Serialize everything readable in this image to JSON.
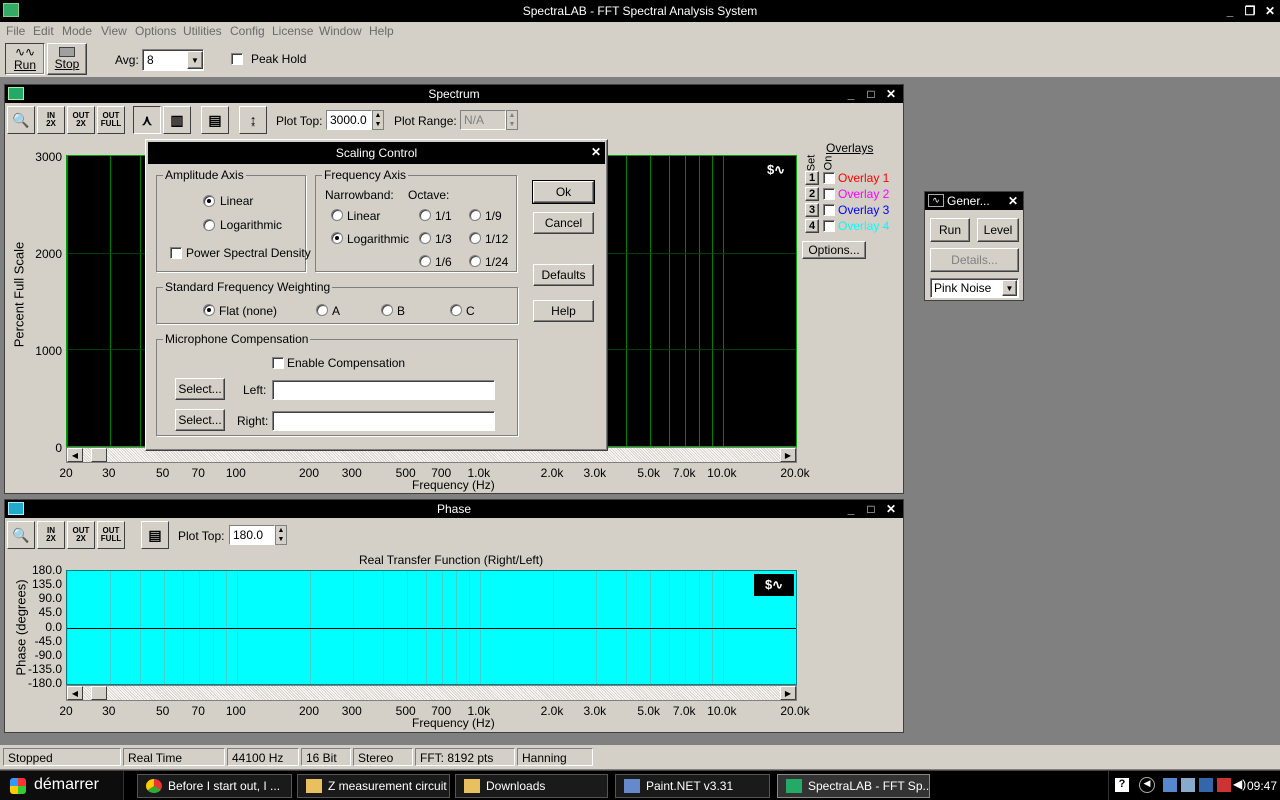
{
  "app": {
    "title": "SpectraLAB - FFT Spectral Analysis System",
    "menu": [
      "File",
      "Edit",
      "Mode",
      "View",
      "Options",
      "Utilities",
      "Config",
      "License",
      "Window",
      "Help"
    ],
    "toolbar": {
      "run_label": "Run",
      "stop_label": "Stop",
      "avg_label": "Avg:",
      "avg_value": "8",
      "peak_hold_label": "Peak Hold"
    }
  },
  "spectrum": {
    "title": "Spectrum",
    "plot_top_label": "Plot Top:",
    "plot_top_value": "3000.0",
    "plot_range_label": "Plot Range:",
    "plot_range_value": "N/A",
    "ylabel": "Percent Full Scale",
    "xlabel": "Frequency (Hz)",
    "y_ticks": [
      "3000",
      "2000",
      "1000",
      "0"
    ],
    "x_ticks": [
      "20",
      "30",
      "50",
      "70",
      "100",
      "200",
      "300",
      "500",
      "700",
      "1.0k",
      "2.0k",
      "3.0k",
      "5.0k",
      "7.0k",
      "10.0k",
      "20.0k"
    ],
    "overlays_title": "Overlays",
    "set_label": "Set",
    "on_label": "On",
    "overlays": [
      {
        "num": "1",
        "name": "Overlay 1",
        "color": "#ff0000"
      },
      {
        "num": "2",
        "name": "Overlay 2",
        "color": "#ff00ff"
      },
      {
        "num": "3",
        "name": "Overlay 3",
        "color": "#0000ff"
      },
      {
        "num": "4",
        "name": "Overlay 4",
        "color": "#00ffff"
      }
    ],
    "options_label": "Options...",
    "tb_labels": {
      "zoom_in": "IN\n2X",
      "zoom_out": "OUT\n2X",
      "full": "OUT\nFULL"
    }
  },
  "dialog": {
    "title": "Scaling Control",
    "amplitude_axis": "Amplitude Axis",
    "linear": "Linear",
    "logarithmic": "Logarithmic",
    "psd": "Power Spectral Density",
    "frequency_axis": "Frequency Axis",
    "narrowband": "Narrowband:",
    "octave": "Octave:",
    "octaves": [
      "1/1",
      "1/9",
      "1/3",
      "1/12",
      "1/6",
      "1/24"
    ],
    "weighting_title": "Standard Frequency Weighting",
    "weightings": [
      "Flat (none)",
      "A",
      "B",
      "C"
    ],
    "mic_title": "Microphone Compensation",
    "enable_comp": "Enable Compensation",
    "select": "Select...",
    "left": "Left:",
    "right": "Right:",
    "left_value": "",
    "right_value": "",
    "ok": "Ok",
    "cancel": "Cancel",
    "defaults": "Defaults",
    "help": "Help"
  },
  "generator": {
    "title": "Gener...",
    "run": "Run",
    "level": "Level",
    "details": "Details...",
    "noise_value": "Pink Noise"
  },
  "phase": {
    "title": "Phase",
    "plot_top_label": "Plot Top:",
    "plot_top_value": "180.0",
    "chart_title": "Real Transfer Function (Right/Left)",
    "ylabel": "Phase (degrees)",
    "xlabel": "Frequency (Hz)",
    "y_ticks": [
      "180.0",
      "135.0",
      "90.0",
      "45.0",
      "0.0",
      "-45.0",
      "-90.0",
      "-135.0",
      "-180.0"
    ],
    "x_ticks": [
      "20",
      "30",
      "50",
      "70",
      "100",
      "200",
      "300",
      "500",
      "700",
      "1.0k",
      "2.0k",
      "3.0k",
      "5.0k",
      "7.0k",
      "10.0k",
      "20.0k"
    ]
  },
  "status": [
    "Stopped",
    "Real Time",
    "44100 Hz",
    "16 Bit",
    "Stereo",
    "FFT: 8192 pts",
    "Hanning"
  ],
  "taskbar": {
    "start": "démarrer",
    "tasks": [
      "Before I start out, I ...",
      "Z measurement circuit",
      "Downloads",
      "Paint.NET v3.31",
      "SpectraLAB - FFT Sp..."
    ],
    "clock": "09:47"
  },
  "colors": {
    "spectrum_bg": "#000000",
    "grid_green": "#008000",
    "phase_bg": "#00ffff"
  },
  "chart_data": [
    {
      "type": "line",
      "title": "",
      "xlabel": "Frequency (Hz)",
      "ylabel": "Percent Full Scale",
      "x_scale": "log",
      "xlim": [
        20,
        20000
      ],
      "ylim": [
        0,
        3000
      ],
      "grid": true,
      "series": []
    },
    {
      "type": "line",
      "title": "Real Transfer Function (Right/Left)",
      "xlabel": "Frequency (Hz)",
      "ylabel": "Phase (degrees)",
      "x_scale": "log",
      "xlim": [
        20,
        20000
      ],
      "ylim": [
        -180,
        180
      ],
      "grid": true,
      "series": []
    }
  ]
}
